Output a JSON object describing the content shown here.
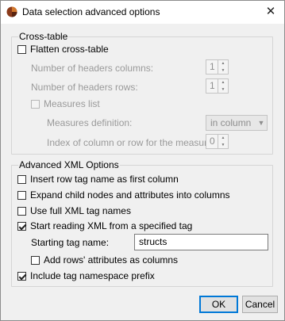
{
  "window": {
    "title": "Data selection advanced options",
    "close_symbol": "✕"
  },
  "cross_table": {
    "group_title": "Cross-table",
    "flatten": {
      "label": "Flatten cross-table",
      "checked": false
    },
    "header_columns": {
      "label": "Number of headers columns:",
      "value": "1"
    },
    "header_rows": {
      "label": "Number of headers rows:",
      "value": "1"
    },
    "measures_list": {
      "label": "Measures list",
      "checked": false
    },
    "measures_definition": {
      "label": "Measures definition:",
      "value": "in column"
    },
    "measures_index": {
      "label": "Index of column or row for the measures:",
      "value": "0"
    }
  },
  "advanced_xml": {
    "group_title": "Advanced XML Options",
    "insert_row_tag": {
      "label": "Insert row tag name as first column",
      "checked": false
    },
    "expand_child_nodes": {
      "label": "Expand child nodes and attributes into columns",
      "checked": false
    },
    "use_full_tag_names": {
      "label": "Use full XML tag names",
      "checked": false
    },
    "start_reading": {
      "label": "Start reading XML from a specified tag",
      "checked": true
    },
    "starting_tag": {
      "label": "Starting tag name:",
      "value": "structs"
    },
    "add_rows_attributes": {
      "label": "Add rows' attributes as columns",
      "checked": false
    },
    "include_namespace": {
      "label": "Include tag namespace prefix",
      "checked": true
    }
  },
  "buttons": {
    "ok": "OK",
    "cancel": "Cancel"
  },
  "icons": {
    "app": "app-logo-icon",
    "close": "close-icon",
    "spin_up": "spin-up-icon",
    "spin_down": "spin-down-icon",
    "dropdown": "chevron-down-icon"
  }
}
